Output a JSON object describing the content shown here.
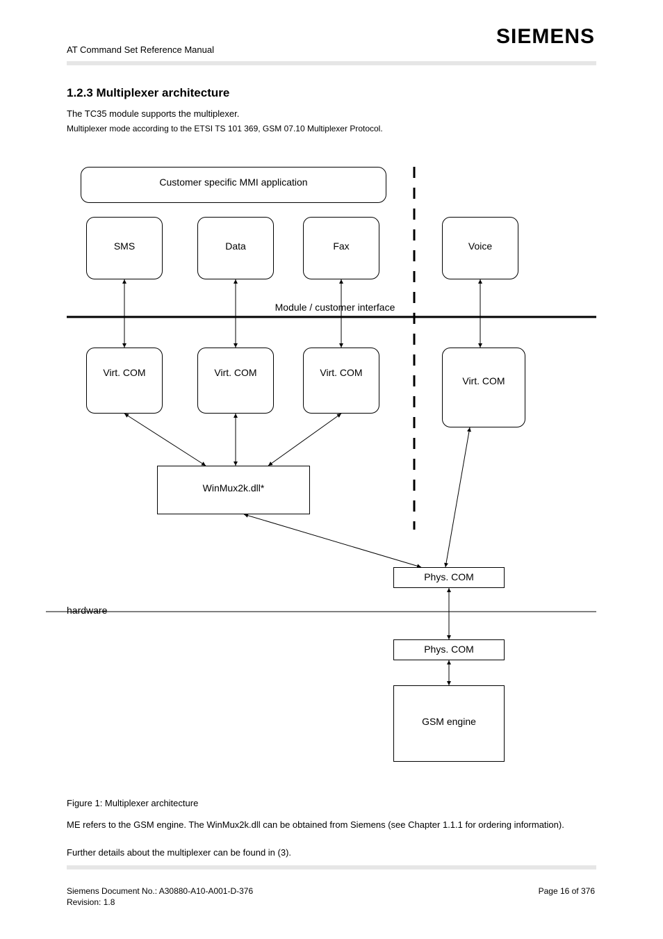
{
  "brand": "SIEMENS",
  "doc_title": "AT Command Set Reference Manual",
  "section_heading": "1.2.3 Multiplexer architecture",
  "intro_line": "The TC35 module supports the multiplexer.",
  "mux_desc": "Multiplexer mode according to the ETSI TS 101 369, GSM 07.10 Multiplexer Protocol.",
  "diagram": {
    "top_bar": "Customer specific MMI application",
    "top_row": [
      "SMS",
      "Data",
      "Fax",
      "Voice"
    ],
    "split_label": "Module / customer interface",
    "mid_row": [
      "Virt. COM",
      "Virt. COM",
      "Virt. COM",
      "Virt. COM"
    ],
    "winmux": "WinMux2k.dll*",
    "phys_com": "Phys. COM",
    "hw_label": "hardware",
    "module_com": "Phys. COM",
    "gsm_engine": "GSM engine"
  },
  "figure_caption": "Figure 1: Multiplexer architecture",
  "para1": "ME refers to the GSM engine. The WinMux2k.dll can be obtained from Siemens (see Chapter 1.1.1 for ordering information).",
  "para2": "Further details about the multiplexer can be found in (3).",
  "footer_left": "Siemens Document No.: A30880-A10-A001-D-376",
  "footer_right": "Page 16 of 376",
  "footer_line2": "Revision: 1.8"
}
